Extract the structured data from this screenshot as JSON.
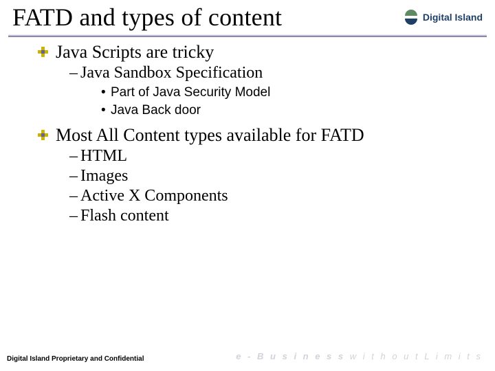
{
  "title": "FATD and types of content",
  "logo_text": "Digital Island",
  "bullets": [
    {
      "text": "Java Scripts are tricky",
      "sub": [
        {
          "text": "Java Sandbox Specification",
          "sub": [
            {
              "text": "Part of Java Security Model"
            },
            {
              "text": "Java Back door"
            }
          ]
        }
      ]
    },
    {
      "text": "Most All Content types available for FATD",
      "sub": [
        {
          "text": "HTML"
        },
        {
          "text": "Images"
        },
        {
          "text": "Active X Components"
        },
        {
          "text": "Flash content"
        }
      ]
    }
  ],
  "footer": "Digital Island Proprietary and Confidential",
  "tagline_prefix": "e - B u s i n e s s",
  "tagline_suffix": "  w i t h o u t   L i m i t s"
}
